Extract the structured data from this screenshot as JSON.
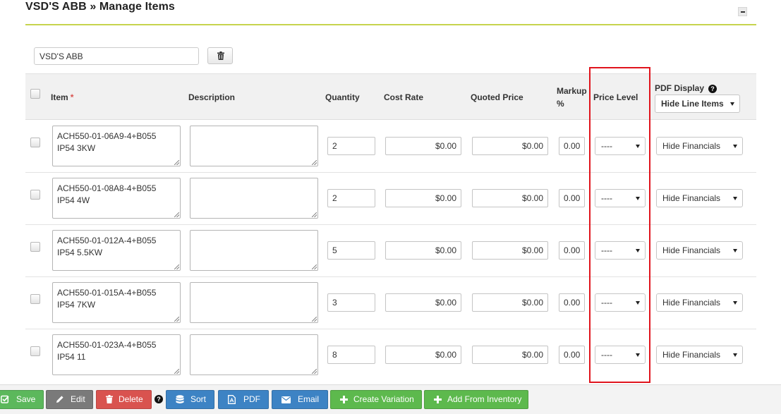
{
  "page": {
    "title": "VSD'S ABB » Manage Items"
  },
  "group": {
    "name_value": "VSD'S ABB"
  },
  "columns": {
    "item": "Item",
    "required_mark": "*",
    "description": "Description",
    "quantity": "Quantity",
    "cost_rate": "Cost Rate",
    "quoted_price": "Quoted Price",
    "markup_line1": "Markup",
    "markup_line2": "%",
    "price_level": "Price Level",
    "pdf_display": "PDF Display",
    "pdf_display_help": "?",
    "pdf_display_select": "Hide Line Items"
  },
  "rows": [
    {
      "item": "ACH550-01-06A9-4+B055 IP54 3KW",
      "description": "",
      "quantity": "2",
      "cost_rate": "$0.00",
      "quoted_price": "$0.00",
      "markup": "0.00",
      "price_level": "----",
      "pdf_display": "Hide Financials"
    },
    {
      "item": "ACH550-01-08A8-4+B055 IP54 4W",
      "description": "",
      "quantity": "2",
      "cost_rate": "$0.00",
      "quoted_price": "$0.00",
      "markup": "0.00",
      "price_level": "----",
      "pdf_display": "Hide Financials"
    },
    {
      "item": "ACH550-01-012A-4+B055 IP54 5.5KW",
      "description": "",
      "quantity": "5",
      "cost_rate": "$0.00",
      "quoted_price": "$0.00",
      "markup": "0.00",
      "price_level": "----",
      "pdf_display": "Hide Financials"
    },
    {
      "item": "ACH550-01-015A-4+B055 IP54 7KW",
      "description": "",
      "quantity": "3",
      "cost_rate": "$0.00",
      "quoted_price": "$0.00",
      "markup": "0.00",
      "price_level": "----",
      "pdf_display": "Hide Financials"
    },
    {
      "item": "ACH550-01-023A-4+B055 IP54 11",
      "description": "",
      "quantity": "8",
      "cost_rate": "$0.00",
      "quoted_price": "$0.00",
      "markup": "0.00",
      "price_level": "----",
      "pdf_display": "Hide Financials"
    }
  ],
  "actions": {
    "save": "Save",
    "edit": "Edit",
    "delete": "Delete",
    "help": "?",
    "sort": "Sort",
    "pdf": "PDF",
    "email": "Email",
    "create_variation": "Create Variation",
    "add_from_inventory": "Add From Inventory"
  },
  "colors": {
    "accent_rule": "#c6d44e",
    "highlight": "#e0141d",
    "save": "#5cb85c",
    "edit": "#7a7a7a",
    "delete": "#d9534f",
    "blue": "#3d83c4",
    "lime": "#5db94d"
  },
  "icons": {
    "collapse": "minus-icon",
    "trash": "trash-icon",
    "save": "check-square-icon",
    "edit": "pencil-icon",
    "delete": "trash-icon",
    "sort": "database-icon",
    "pdf": "pdf-file-icon",
    "email": "envelope-icon",
    "create_variation": "plus-icon",
    "add_from_inventory": "plus-icon"
  }
}
